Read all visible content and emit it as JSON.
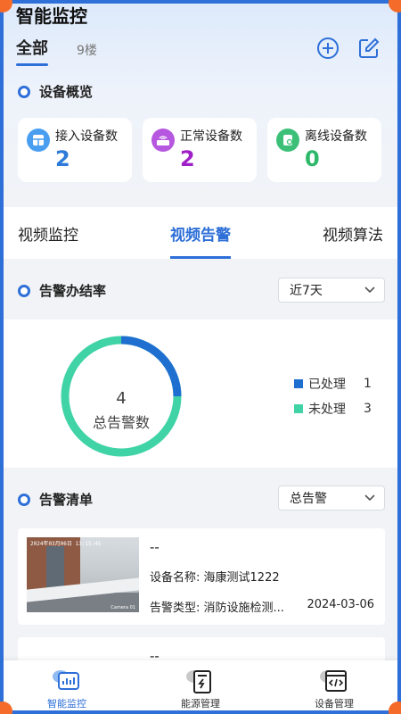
{
  "app": {
    "title": "智能监控"
  },
  "scope_tabs": [
    {
      "label": "全部",
      "active": true
    },
    {
      "label": "9楼",
      "active": false
    }
  ],
  "top_actions": [
    {
      "icon": "plus-circle-icon"
    },
    {
      "icon": "edit-square-icon"
    }
  ],
  "overview": {
    "title": "设备概览",
    "cards": [
      {
        "label": "接入设备数",
        "value": "2",
        "color": "#2e7ad8",
        "icon": "device-grid-icon",
        "icon_bg": "#4a9ef0"
      },
      {
        "label": "正常设备数",
        "value": "2",
        "color": "#a020c8",
        "icon": "router-icon",
        "icon_bg": "#b657e0"
      },
      {
        "label": "离线设备数",
        "value": "0",
        "color": "#2db86a",
        "icon": "device-offline-icon",
        "icon_bg": "#3cc078"
      }
    ]
  },
  "video_tabs": [
    {
      "label": "视频监控",
      "active": false
    },
    {
      "label": "视频告警",
      "active": true
    },
    {
      "label": "视频算法",
      "active": false
    }
  ],
  "rate": {
    "title": "告警办结率",
    "period": "近7天",
    "total": "4",
    "total_label": "总告警数",
    "legend": [
      {
        "label": "已处理",
        "count": "1",
        "color": "#1f6fd0"
      },
      {
        "label": "未处理",
        "count": "3",
        "color": "#3fd3a6"
      }
    ]
  },
  "alarm_list": {
    "title": "告警清单",
    "filter": "总告警",
    "items": [
      {
        "title": "--",
        "device_label": "设备名称:",
        "device": "海康测试1222",
        "type_label": "告警类型:",
        "type": "消防设施检测...",
        "date": "2024-03-06",
        "thumb_time": "2024年03月06日  13:15:45",
        "thumb_cam": "Camera 01"
      },
      {
        "title": "--"
      }
    ]
  },
  "bottom_nav": [
    {
      "label": "智能监控",
      "active": true,
      "icon": "monitor-chart-icon"
    },
    {
      "label": "能源管理",
      "active": false,
      "icon": "energy-meter-icon"
    },
    {
      "label": "设备管理",
      "active": false,
      "icon": "device-code-icon"
    }
  ]
}
